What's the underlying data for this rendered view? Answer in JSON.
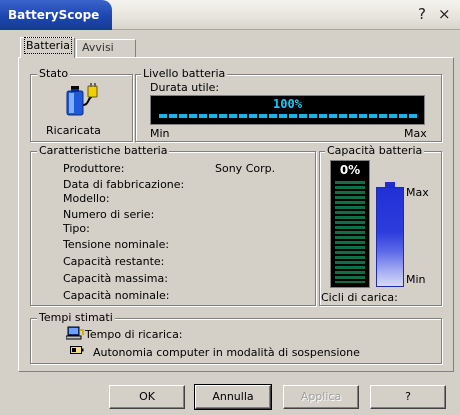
{
  "window": {
    "title": "BatteryScope",
    "help_glyph": "?",
    "close_glyph": "×"
  },
  "tabs": [
    "Batteria",
    "Avvisi"
  ],
  "status": {
    "group_label": "Stato",
    "state_text": "Ricaricata"
  },
  "level": {
    "group_label": "Livello batteria",
    "duration_label": "Durata utile:",
    "percent_text": "100%",
    "percent_value": 100,
    "min_label": "Min",
    "max_label": "Max"
  },
  "characteristics": {
    "group_label": "Caratteristiche batteria",
    "rows": [
      {
        "label": "Produttore:",
        "value": "Sony Corp."
      },
      {
        "label": "Data di fabbricazione:",
        "value": ""
      },
      {
        "label": "Modello:",
        "value": ""
      },
      {
        "label": "Numero di serie:",
        "value": ""
      },
      {
        "label": "Tipo:",
        "value": ""
      },
      {
        "label": "Tensione nominale:",
        "value": ""
      },
      {
        "label": "Capacità restante:",
        "value": ""
      },
      {
        "label": "Capacità massima:",
        "value": ""
      },
      {
        "label": "Capacità nominale:",
        "value": ""
      }
    ]
  },
  "capacity": {
    "group_label": "Capacità batteria",
    "percent_text": "0%",
    "max_label": "Max",
    "min_label": "Min",
    "cycles_label": "Cicli di carica:"
  },
  "estimates": {
    "group_label": "Tempi stimati",
    "charge_time_label": "Tempo di ricarica:",
    "standby_label": "Autonomia computer in modalità di sospensione"
  },
  "buttons": {
    "ok": "OK",
    "cancel": "Annulla",
    "apply": "Applica",
    "help": "?"
  },
  "colors": {
    "title_blue": "#1d47b0",
    "level_cyan": "#1ec8ff",
    "capacity_green": "#0e6e46",
    "battery_blue": "#2130d6"
  }
}
